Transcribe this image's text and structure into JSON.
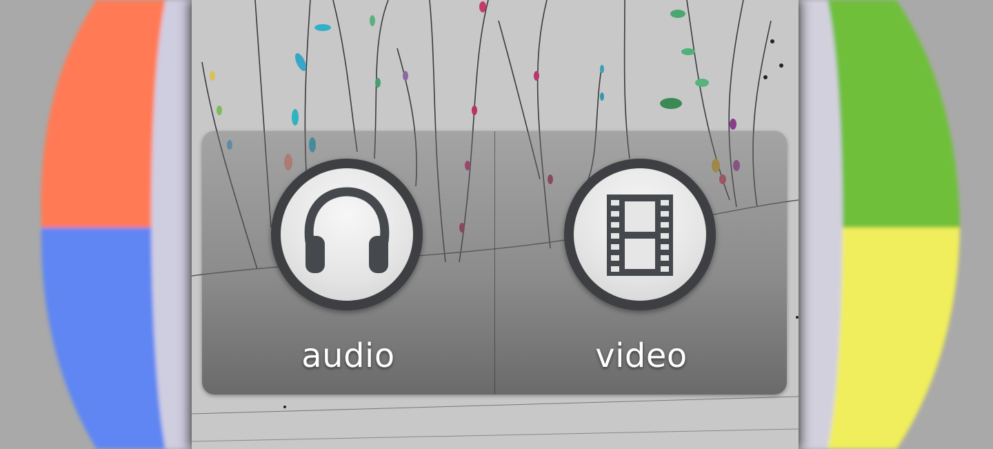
{
  "chooser": {
    "options": [
      {
        "label": "audio",
        "icon": "headphones-icon"
      },
      {
        "label": "video",
        "icon": "film-strip-icon"
      }
    ]
  },
  "colors": {
    "backdrop_gray": "#a9a9a9",
    "wheel_red": "#ff7a55",
    "wheel_blue": "#5f86f2",
    "wheel_green": "#6fbf3a",
    "wheel_yellow": "#f0ee5c",
    "icon_dark": "#45484c"
  }
}
